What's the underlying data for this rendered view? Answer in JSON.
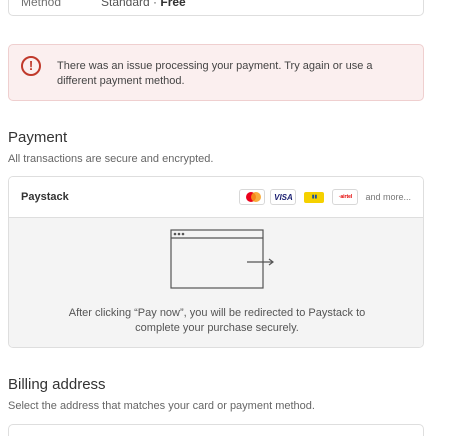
{
  "shipping_method": {
    "label": "Method",
    "value_prefix": "Standard · ",
    "value_strong": "Free"
  },
  "error": {
    "icon": "exclamation-circle-icon",
    "message": "There was an issue processing your payment. Try again or use a different payment method.",
    "color": "#c0392b"
  },
  "payment": {
    "title": "Payment",
    "subtitle": "All transactions are secure and encrypted.",
    "provider": "Paystack",
    "card_brands": [
      "mastercard",
      "visa",
      "verve",
      "airtel-money"
    ],
    "visa_label": "VISA",
    "more_label": "and more...",
    "redirect_message": "After clicking “Pay now”, you will be redirected to Paystack to complete your purchase securely."
  },
  "billing": {
    "title": "Billing address",
    "subtitle": "Select the address that matches your card or payment method."
  }
}
